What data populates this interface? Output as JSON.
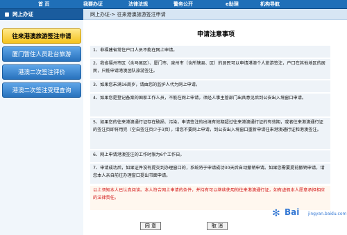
{
  "topnav": [
    "首  页",
    "我要办证",
    "法律法规",
    "警务公开",
    "e助理",
    "机构导航"
  ],
  "sidebar": {
    "header": "网上办证",
    "items": [
      {
        "label": "往来港澳旅游签注申请",
        "active": true
      },
      {
        "label": "厦门暂住人员赴台旅游",
        "active": false
      },
      {
        "label": "港澳二次签注评价",
        "active": false
      },
      {
        "label": "港澳二次签注受理查询",
        "active": false
      }
    ]
  },
  "breadcrumb": "网上办证-> 往来港澳旅游签注申请",
  "main": {
    "title": "申请注意事项",
    "items": [
      "1、非福建省常住户口人员不能在网上申请。",
      "2、我省福州市区（含马尾区）、厦门市、泉州市（含所辖县、区）的居民可以申请港澳个人旅游签注，户口在其他地区的居民，只能申请港澳团队旅游签注。",
      "3、如果您未满16周岁，请由您的监护人代为网上申请。",
      "4、如果您是登记备案的国家工作人员，不能在网上申请，须经人事主管部门出具意见后到公安出入境窗口申请。",
      "5、如果您的往来港澳通行证存在破损、污染，申请签注的出境有效期超过往来港澳通行证的有效期，或者往来港澳通行证的签注页即将用完（空白签注页少于3页），请您不要网上申请，到公安出入境窗口重新申请往来港澳通行证和港澳签注。",
      "6、网上申请港澳签注的工作时限为6个工作日。",
      "7、申请成功后，如果证件没有提交到办理窗口的，系统将于申请成功30天后自动撤销申请。如果您需要提前撤销申请，请您本人亲自前往办理窗口提出书面申请。"
    ],
    "warning": "以上须知本人已认真阅读。本人符合网上申请的条件，并持有可以继续使用的往来港澳通行证，如有虚假本人愿意承担相应的法律责任。",
    "agree_label": "同 意",
    "cancel_label": "取 消"
  },
  "watermark": {
    "brand": "Bai",
    "sub": "jingyan.baidu.com"
  },
  "colors": {
    "nav": "#1f6fb8",
    "active": "#f4c21e",
    "warning": "#d21313"
  }
}
